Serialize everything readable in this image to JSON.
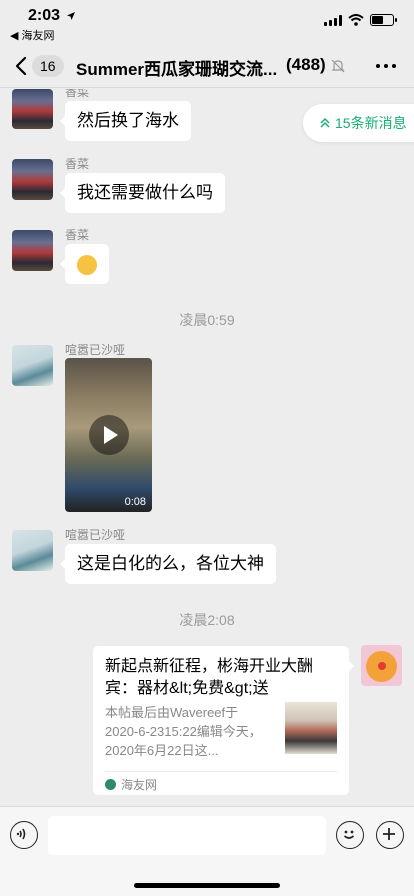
{
  "status": {
    "time": "2:03",
    "back_app": "◀ 海友网"
  },
  "nav": {
    "badge": "16",
    "title": "Summer西瓜家珊瑚交流...",
    "member_count": "(488)"
  },
  "new_messages": "15条新消息",
  "messages": [
    {
      "sender": "香菜",
      "text": "然后换了海水"
    },
    {
      "sender": "香菜",
      "text": "我还需要做什么吗"
    },
    {
      "sender": "香菜",
      "emoji": "dizzy-face-icon"
    },
    {
      "timestamp": "凌晨0:59"
    },
    {
      "sender": "喧嚣已沙哑",
      "video_duration": "0:08"
    },
    {
      "sender": "喧嚣已沙哑",
      "text": "这是白化的么，各位大神"
    },
    {
      "timestamp": "凌晨2:08"
    }
  ],
  "link_card": {
    "title": "新起点新征程，彬海开业大酬宾：器材&lt;免费&gt;送",
    "description": "本帖最后由Wavereef于2020-6-2315:22编辑今天，2020年6月22日这...",
    "source": "海友网"
  },
  "colors": {
    "accent_green": "#1aad74",
    "background": "#ededed"
  }
}
